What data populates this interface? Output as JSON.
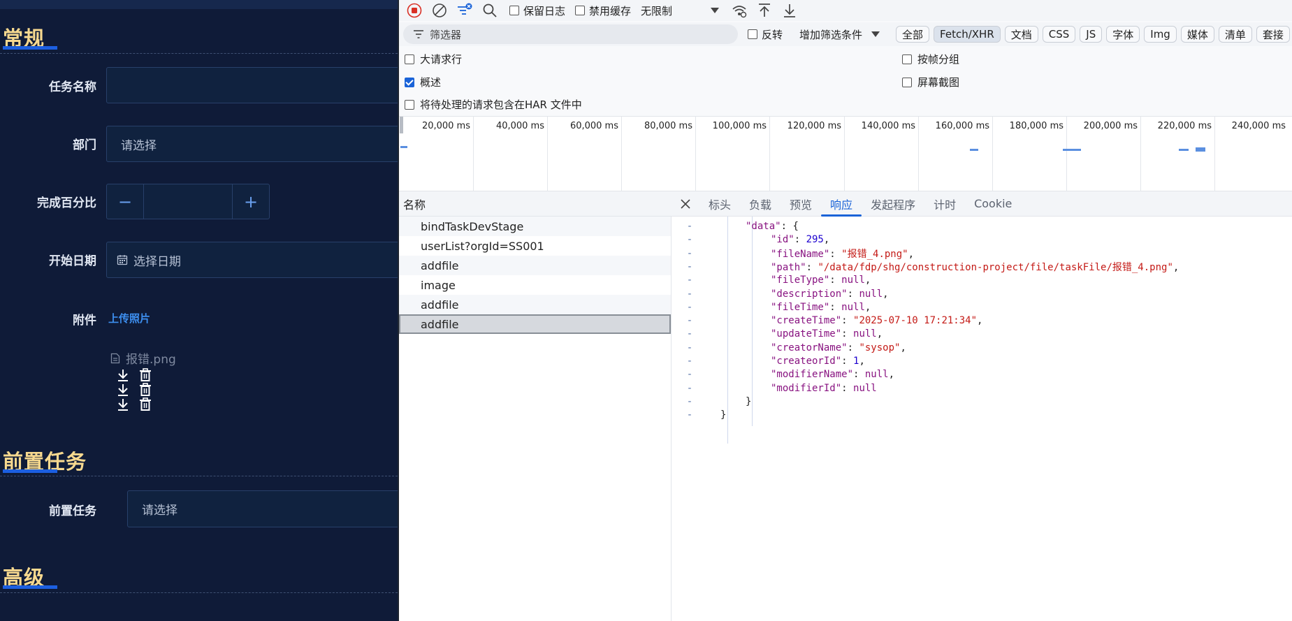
{
  "form": {
    "sections": {
      "general": "常规",
      "predecessor": "前置任务",
      "advanced": "高级"
    },
    "fields": {
      "task_name_label": "任务名称",
      "dept_label": "部门",
      "dept_placeholder": "请选择",
      "percent_label": "完成百分比",
      "percent_minus": "−",
      "percent_plus": "+",
      "start_date_label": "开始日期",
      "start_date_placeholder": "选择日期",
      "attachment_label": "附件",
      "upload_link": "上传照片",
      "attached_file": "报错.png",
      "predecessor_label": "前置任务",
      "predecessor_placeholder": "请选择"
    },
    "colors": {
      "background": "#0f1b38",
      "title": "#f7d98f",
      "accent": "#1c5fe0",
      "link": "#3d8ff0"
    }
  },
  "devtools": {
    "toolbar": {
      "preserve_log": "保留日志",
      "disable_cache": "禁用缓存",
      "throttle": "无限制"
    },
    "filter": {
      "placeholder": "筛选器",
      "invert": "反转",
      "more_filters": "增加筛选条件",
      "types": [
        "全部",
        "Fetch/XHR",
        "文档",
        "CSS",
        "JS",
        "字体",
        "Img",
        "媒体",
        "清单",
        "套接"
      ],
      "active_type": "Fetch/XHR"
    },
    "options": {
      "big_rows": "大请求行",
      "group_by_frame": "按帧分组",
      "overview": "概述",
      "screenshots": "屏幕截图",
      "har_include_pending": "将待处理的请求包含在HAR 文件中"
    },
    "overview_ticks": [
      "20,000 ms",
      "40,000 ms",
      "60,000 ms",
      "80,000 ms",
      "100,000 ms",
      "120,000 ms",
      "140,000 ms",
      "160,000 ms",
      "180,000 ms",
      "200,000 ms",
      "220,000 ms",
      "240,000 ms"
    ],
    "requests": {
      "header": "名称",
      "items": [
        "bindTaskDevStage",
        "userList?orgId=SS001",
        "addfile",
        "image",
        "addfile",
        "addfile"
      ],
      "selected_index": 5
    },
    "detail_tabs": [
      "标头",
      "负载",
      "预览",
      "响应",
      "发起程序",
      "计时",
      "Cookie"
    ],
    "active_tab": "响应",
    "response_lines": [
      {
        "gutter": "-",
        "indent": 1,
        "key": "\"data\"",
        "sep": ": ",
        "value": "{",
        "vtype": "p",
        "comma": ""
      },
      {
        "gutter": "-",
        "indent": 2,
        "key": "\"id\"",
        "sep": ": ",
        "value": "295",
        "vtype": "n",
        "comma": ","
      },
      {
        "gutter": "-",
        "indent": 2,
        "key": "\"fileName\"",
        "sep": ": ",
        "value": "\"报错_4.png\"",
        "vtype": "s",
        "comma": ","
      },
      {
        "gutter": "-",
        "indent": 2,
        "key": "\"path\"",
        "sep": ": ",
        "value": "\"/data/fdp/shg/construction-project/file/taskFile/报错_4.png\"",
        "vtype": "s",
        "comma": ","
      },
      {
        "gutter": "-",
        "indent": 2,
        "key": "\"fileType\"",
        "sep": ": ",
        "value": "null",
        "vtype": "nl",
        "comma": ","
      },
      {
        "gutter": "-",
        "indent": 2,
        "key": "\"description\"",
        "sep": ": ",
        "value": "null",
        "vtype": "nl",
        "comma": ","
      },
      {
        "gutter": "-",
        "indent": 2,
        "key": "\"fileTime\"",
        "sep": ": ",
        "value": "null",
        "vtype": "nl",
        "comma": ","
      },
      {
        "gutter": "-",
        "indent": 2,
        "key": "\"createTime\"",
        "sep": ": ",
        "value": "\"2025-07-10 17:21:34\"",
        "vtype": "s",
        "comma": ","
      },
      {
        "gutter": "-",
        "indent": 2,
        "key": "\"updateTime\"",
        "sep": ": ",
        "value": "null",
        "vtype": "nl",
        "comma": ","
      },
      {
        "gutter": "-",
        "indent": 2,
        "key": "\"creatorName\"",
        "sep": ": ",
        "value": "\"sysop\"",
        "vtype": "s",
        "comma": ","
      },
      {
        "gutter": "-",
        "indent": 2,
        "key": "\"createorId\"",
        "sep": ": ",
        "value": "1",
        "vtype": "n",
        "comma": ","
      },
      {
        "gutter": "-",
        "indent": 2,
        "key": "\"modifierName\"",
        "sep": ": ",
        "value": "null",
        "vtype": "nl",
        "comma": ","
      },
      {
        "gutter": "-",
        "indent": 2,
        "key": "\"modifierId\"",
        "sep": ": ",
        "value": "null",
        "vtype": "nl",
        "comma": ""
      },
      {
        "gutter": "-",
        "indent": 1,
        "key": "",
        "sep": "",
        "value": "}",
        "vtype": "p",
        "comma": ""
      },
      {
        "gutter": "-",
        "indent": 0,
        "key": "",
        "sep": "",
        "value": "}",
        "vtype": "p",
        "comma": ""
      }
    ]
  }
}
